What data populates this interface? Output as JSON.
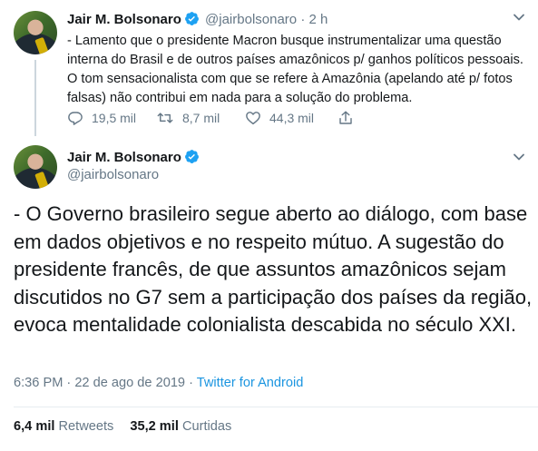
{
  "tweet1": {
    "author_name": "Jair M. Bolsonaro",
    "handle": "@jairbolsonaro",
    "separator": "·",
    "time": "2 h",
    "text": "- Lamento que o presidente Macron busque instrumentalizar uma questão interna do Brasil e de outros países amazônicos p/ ganhos políticos pessoais. O tom sensacionalista com que se refere à Amazônia (apelando até p/ fotos falsas) não contribui em nada para a solução do problema.",
    "replies": "19,5 mil",
    "retweets": "8,7 mil",
    "likes": "44,3 mil"
  },
  "tweet2": {
    "author_name": "Jair M. Bolsonaro",
    "handle": "@jairbolsonaro",
    "text": "- O Governo brasileiro segue aberto ao diálogo, com base em dados objetivos e no respeito mútuo. A sugestão do presidente francês, de que assuntos amazônicos sejam discutidos no G7 sem a participação dos países da região, evoca mentalidade colonialista descabida no século XXI.",
    "timestamp": "6:36 PM · 22 de ago de 2019 ·",
    "source": "Twitter for Android",
    "retweet_count": "6,4 mil",
    "retweet_label": "Retweets",
    "like_count": "35,2 mil",
    "like_label": "Curtidas"
  },
  "icons": {
    "verified": "verified-badge-icon",
    "chevron": "chevron-down-icon",
    "reply": "reply-icon",
    "retweet": "retweet-icon",
    "like": "heart-icon",
    "share": "share-icon"
  },
  "colors": {
    "verified": "#1da1f2",
    "secondary_text": "#657786",
    "link": "#1b95e0",
    "primary_text": "#14171a"
  }
}
